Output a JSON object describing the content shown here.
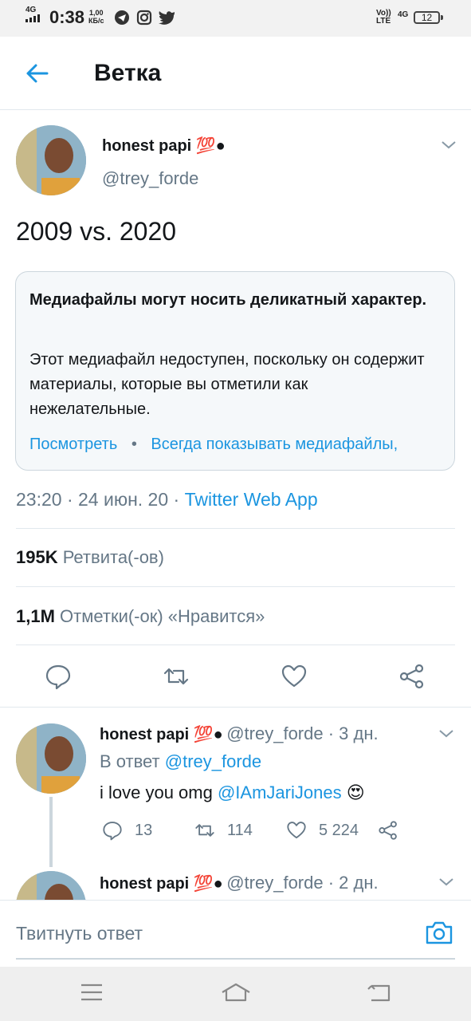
{
  "status_bar": {
    "network": "4G",
    "time": "0:38",
    "speed_value": "1,00",
    "speed_unit": "КБ/с",
    "volte": "Vo))",
    "lte": "LTE",
    "net_right": "4G",
    "battery": "12"
  },
  "header": {
    "title": "Ветка"
  },
  "tweet": {
    "author_name": "honest papi 💯●",
    "author_handle": "@trey_forde",
    "text": "2009 vs. 2020",
    "media_warning": {
      "title": "Медиафайлы могут носить деликатный характер.",
      "body": "Этот медиафайл недоступен, поскольку он содержит материалы, которые вы отметили как нежелательные.",
      "view_link": "Посмотреть",
      "separator": "•",
      "always_show_link": "Всегда показывать медиафайлы,"
    },
    "meta_time": "23:20 · 24 июн. 20 · ",
    "meta_source": "Twitter Web App",
    "retweets_count": "195K",
    "retweets_label": "Ретвита(-ов)",
    "likes_count": "1,1M",
    "likes_label": "Отметки(-ок) «Нравится»"
  },
  "replies": [
    {
      "author_name": "honest papi 💯●",
      "handle_time": "@trey_forde · 3 дн.",
      "reply_to_prefix": "В ответ ",
      "reply_to_handle": "@trey_forde",
      "text": "i love you omg ",
      "mention": "@IAmJariJones",
      "emoji": "😍",
      "replies_count": "13",
      "retweets_count": "114",
      "likes_count": "5 224"
    },
    {
      "author_name": "honest papi 💯●",
      "handle_time": "@trey_forde · 2 дн."
    }
  ],
  "compose": {
    "placeholder": "Твитнуть ответ"
  },
  "colors": {
    "accent": "#1b95e0",
    "text": "#14171a",
    "secondary": "#657786",
    "border": "#e1e8ed"
  },
  "icons": [
    "back-arrow-icon",
    "chevron-down-icon",
    "reply-icon",
    "retweet-icon",
    "like-icon",
    "share-icon",
    "camera-icon",
    "menu-icon",
    "home-icon",
    "back-icon"
  ]
}
